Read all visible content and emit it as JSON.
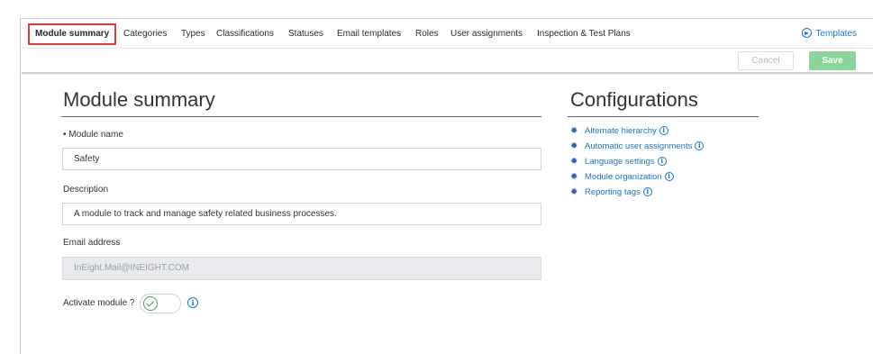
{
  "tabs": [
    {
      "label": "Module summary",
      "active": true
    },
    {
      "label": "Categories"
    },
    {
      "label": "Types"
    },
    {
      "label": "Classifications"
    },
    {
      "label": "Statuses"
    },
    {
      "label": "Email templates"
    },
    {
      "label": "Roles"
    },
    {
      "label": "User assignments"
    },
    {
      "label": "Inspection & Test Plans"
    }
  ],
  "templates_link": {
    "label": "Templates",
    "icon": "arrow-circle-right-icon"
  },
  "actions": {
    "cancel_label": "Cancel",
    "save_label": "Save"
  },
  "summary": {
    "title": "Module summary",
    "module_name": {
      "label": "Module name",
      "required_marker": "•",
      "value": "Safety"
    },
    "description": {
      "label": "Description",
      "value": "A module to track and manage safety related business processes."
    },
    "email": {
      "label": "Email address",
      "value": "InEight.Mail@INEIGHT.COM"
    },
    "activate": {
      "label": "Activate module ?",
      "enabled": true
    }
  },
  "configurations": {
    "title": "Configurations",
    "items": [
      {
        "label": "Alternate hierarchy"
      },
      {
        "label": "Automatic user assignments"
      },
      {
        "label": "Language settings"
      },
      {
        "label": "Module organization"
      },
      {
        "label": "Reporting tags"
      }
    ]
  },
  "colors": {
    "accent": "#1a73c7",
    "active_tab_border": "#e0393e",
    "save_button": "#8bd49a",
    "toggle_on": "#3aa655"
  }
}
